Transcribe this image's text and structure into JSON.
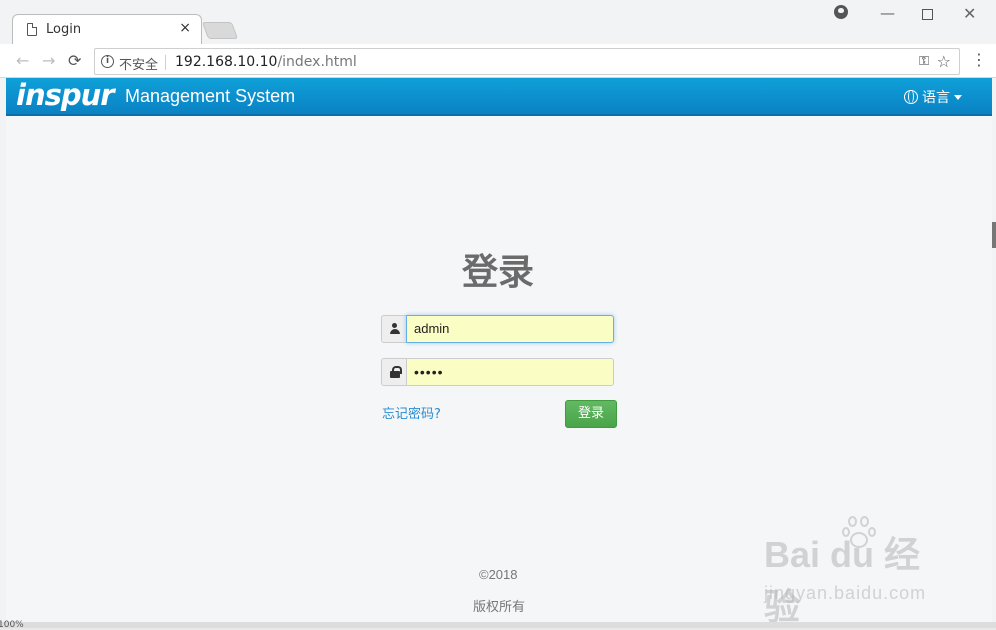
{
  "browser": {
    "tab_title": "Login",
    "tab_close": "×",
    "insecure_label": "不安全",
    "url_host": "192.168.10.10",
    "url_path": "/index.html",
    "zoom": "100%"
  },
  "header": {
    "logo": "inspur",
    "app_name": "Management System",
    "language": "语言"
  },
  "login": {
    "title": "登录",
    "username_value": "admin",
    "password_value": "•••••",
    "forgot_label": "忘记密码?",
    "submit_label": "登录"
  },
  "footer": {
    "copyright": "©2018",
    "rights": "版权所有"
  },
  "watermark": {
    "main": "Bai du 经验",
    "sub": "jingyan.baidu.com"
  },
  "colors": {
    "navbar": "#0a8fcf",
    "login_button": "#5cb85c",
    "autofill": "#fafdc4",
    "link": "#2a8cd1"
  }
}
